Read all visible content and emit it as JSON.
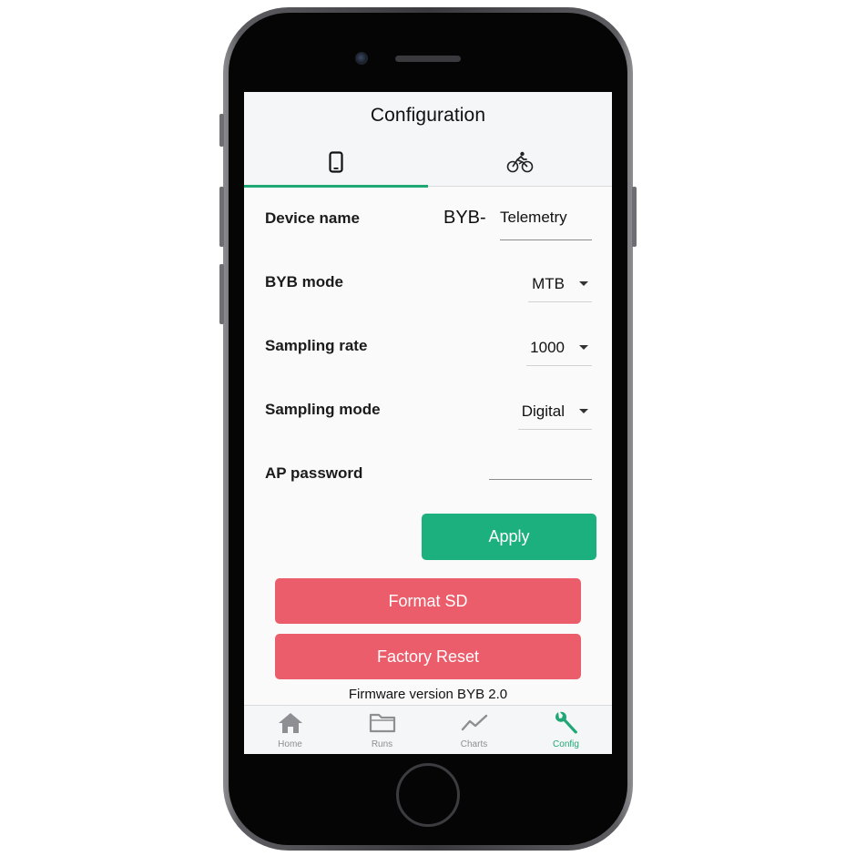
{
  "app": {
    "title": "Configuration"
  },
  "tabs": [
    {
      "icon": "smartphone-icon",
      "active": true
    },
    {
      "icon": "bike-icon",
      "active": false
    }
  ],
  "form": {
    "device_name": {
      "label": "Device name",
      "prefix": "BYB-",
      "value": "Telemetry"
    },
    "byb_mode": {
      "label": "BYB mode",
      "value": "MTB"
    },
    "sampling_rate": {
      "label": "Sampling rate",
      "value": "1000"
    },
    "sampling_mode": {
      "label": "Sampling mode",
      "value": "Digital"
    },
    "ap_password": {
      "label": "AP password",
      "value": ""
    }
  },
  "buttons": {
    "apply": "Apply",
    "format_sd": "Format SD",
    "factory_reset": "Factory Reset"
  },
  "firmware": "Firmware version BYB 2.0",
  "nav": [
    {
      "label": "Home",
      "icon": "home-icon"
    },
    {
      "label": "Runs",
      "icon": "folder-icon"
    },
    {
      "label": "Charts",
      "icon": "chart-line-icon"
    },
    {
      "label": "Config",
      "icon": "wrench-icon",
      "active": true
    }
  ],
  "colors": {
    "accent": "#1fa776",
    "apply": "#1cb07e",
    "danger": "#ec5d6b",
    "nav_inactive": "#8e8e93"
  }
}
